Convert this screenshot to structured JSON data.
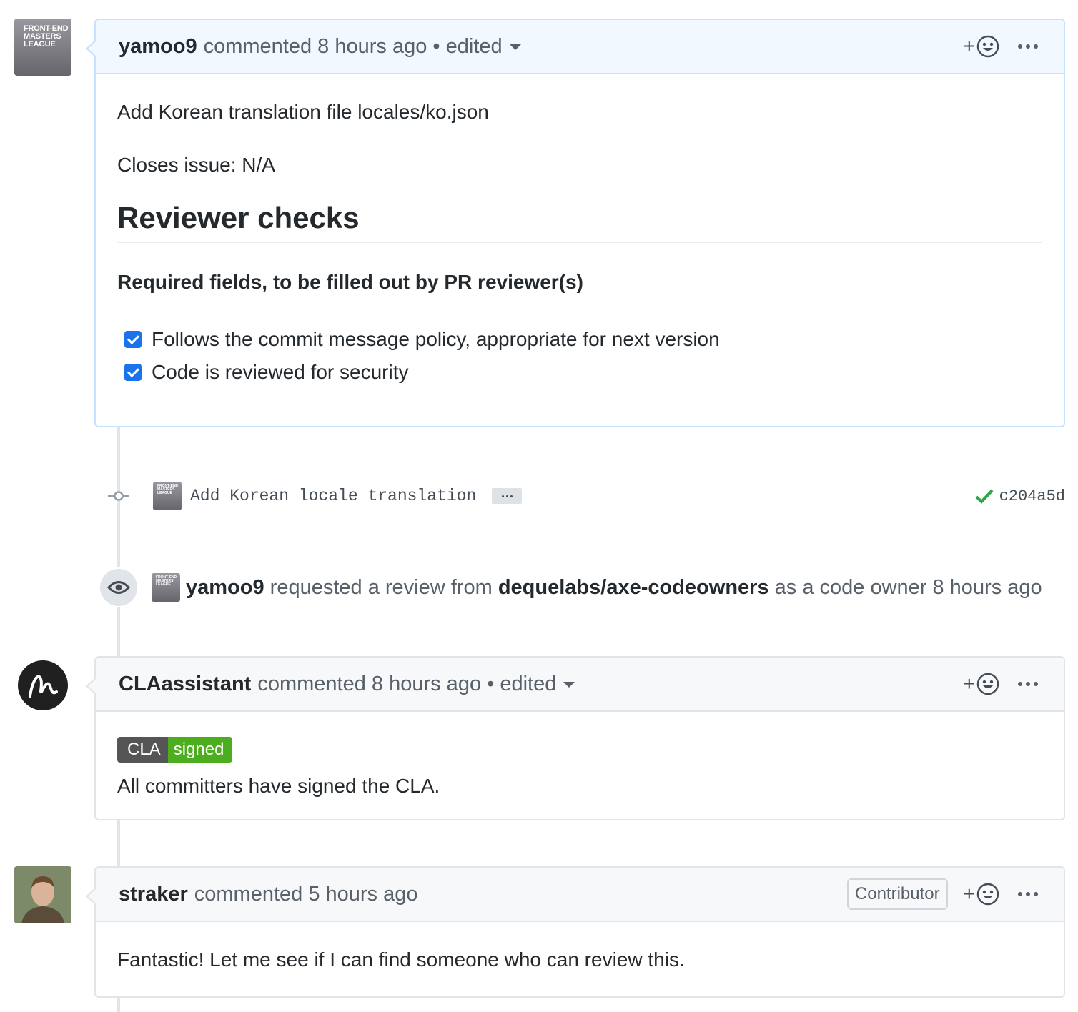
{
  "comment1": {
    "author": "yamoo9",
    "meta": "commented 8 hours ago • edited",
    "body_line1": "Add Korean translation file locales/ko.json",
    "body_line2": "Closes issue: N/A",
    "heading": "Reviewer checks",
    "subheading": "Required fields, to be filled out by PR reviewer(s)",
    "tasks": [
      {
        "label": "Follows the commit message policy, appropriate for next version",
        "checked": true
      },
      {
        "label": "Code is reviewed for security",
        "checked": true
      }
    ]
  },
  "avatar_fem": {
    "text_l1": "FRONT-END",
    "text_l2": "MASTERS",
    "text_l3": "LEAGUE"
  },
  "commit": {
    "message": "Add Korean locale translation",
    "sha": "c204a5d",
    "status_color": "#28a745"
  },
  "review_event": {
    "actor": "yamoo9",
    "text1": "requested a review from",
    "team": "dequelabs/axe-codeowners",
    "text2": "as a code owner 8 hours ago"
  },
  "comment2": {
    "author": "CLAassistant",
    "meta": "commented 8 hours ago • edited",
    "badge_left": "CLA",
    "badge_right": "signed",
    "body": "All committers have signed the CLA."
  },
  "comment3": {
    "author": "straker",
    "meta": "commented 5 hours ago",
    "role_badge": "Contributor",
    "body": "Fantastic! Let me see if I can find someone who can review this."
  },
  "colors": {
    "accent": "#1a73e8",
    "highlight_border": "#c8e1ff",
    "highlight_bg": "#f1f8ff",
    "success": "#28a745"
  }
}
